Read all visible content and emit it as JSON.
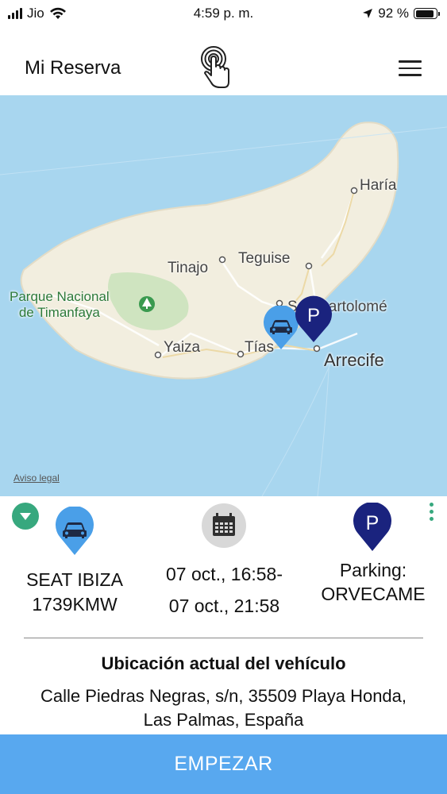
{
  "status_bar": {
    "carrier": "Jio",
    "time": "4:59 p. m.",
    "battery": "92 %",
    "battery_level": 0.92
  },
  "header": {
    "title": "Mi Reserva",
    "touch_icon": "touch-hand-icon",
    "menu_icon": "hamburger-menu-icon"
  },
  "map": {
    "labels": {
      "haria": "Haría",
      "teguise": "Teguise",
      "tinajo": "Tinajo",
      "park": "Parque Nacional\nde Timanfaya",
      "san_bartolome": "San Bartolomé",
      "yaiza": "Yaiza",
      "tias": "Tías",
      "arrecife": "Arrecife"
    },
    "legal_link": "Aviso legal",
    "car_pin_icon": "car-marker-icon",
    "parking_pin_label": "P",
    "colors": {
      "sea": "#a8d6ef",
      "land": "#f2eedf",
      "park": "#cfe4c0",
      "car_pin": "#4a9fe8",
      "parking_pin": "#1a237e"
    }
  },
  "details": {
    "vehicle": {
      "model": "SEAT IBIZA",
      "plate": "1739KMW",
      "icon": "car-pin-icon"
    },
    "dates": {
      "start": "07 oct., 16:58-",
      "end": "07 oct., 21:58",
      "icon": "calendar-icon"
    },
    "parking": {
      "label": "Parking:",
      "name": "ORVECAME",
      "icon_letter": "P"
    },
    "location_title": "Ubicación actual del vehículo",
    "address_line1": "Calle Piedras Negras, s/n, 35509 Playa Honda,",
    "address_line2": "Las Palmas, España"
  },
  "start_button": {
    "label": "EMPEZAR",
    "color": "#58a8ef"
  }
}
